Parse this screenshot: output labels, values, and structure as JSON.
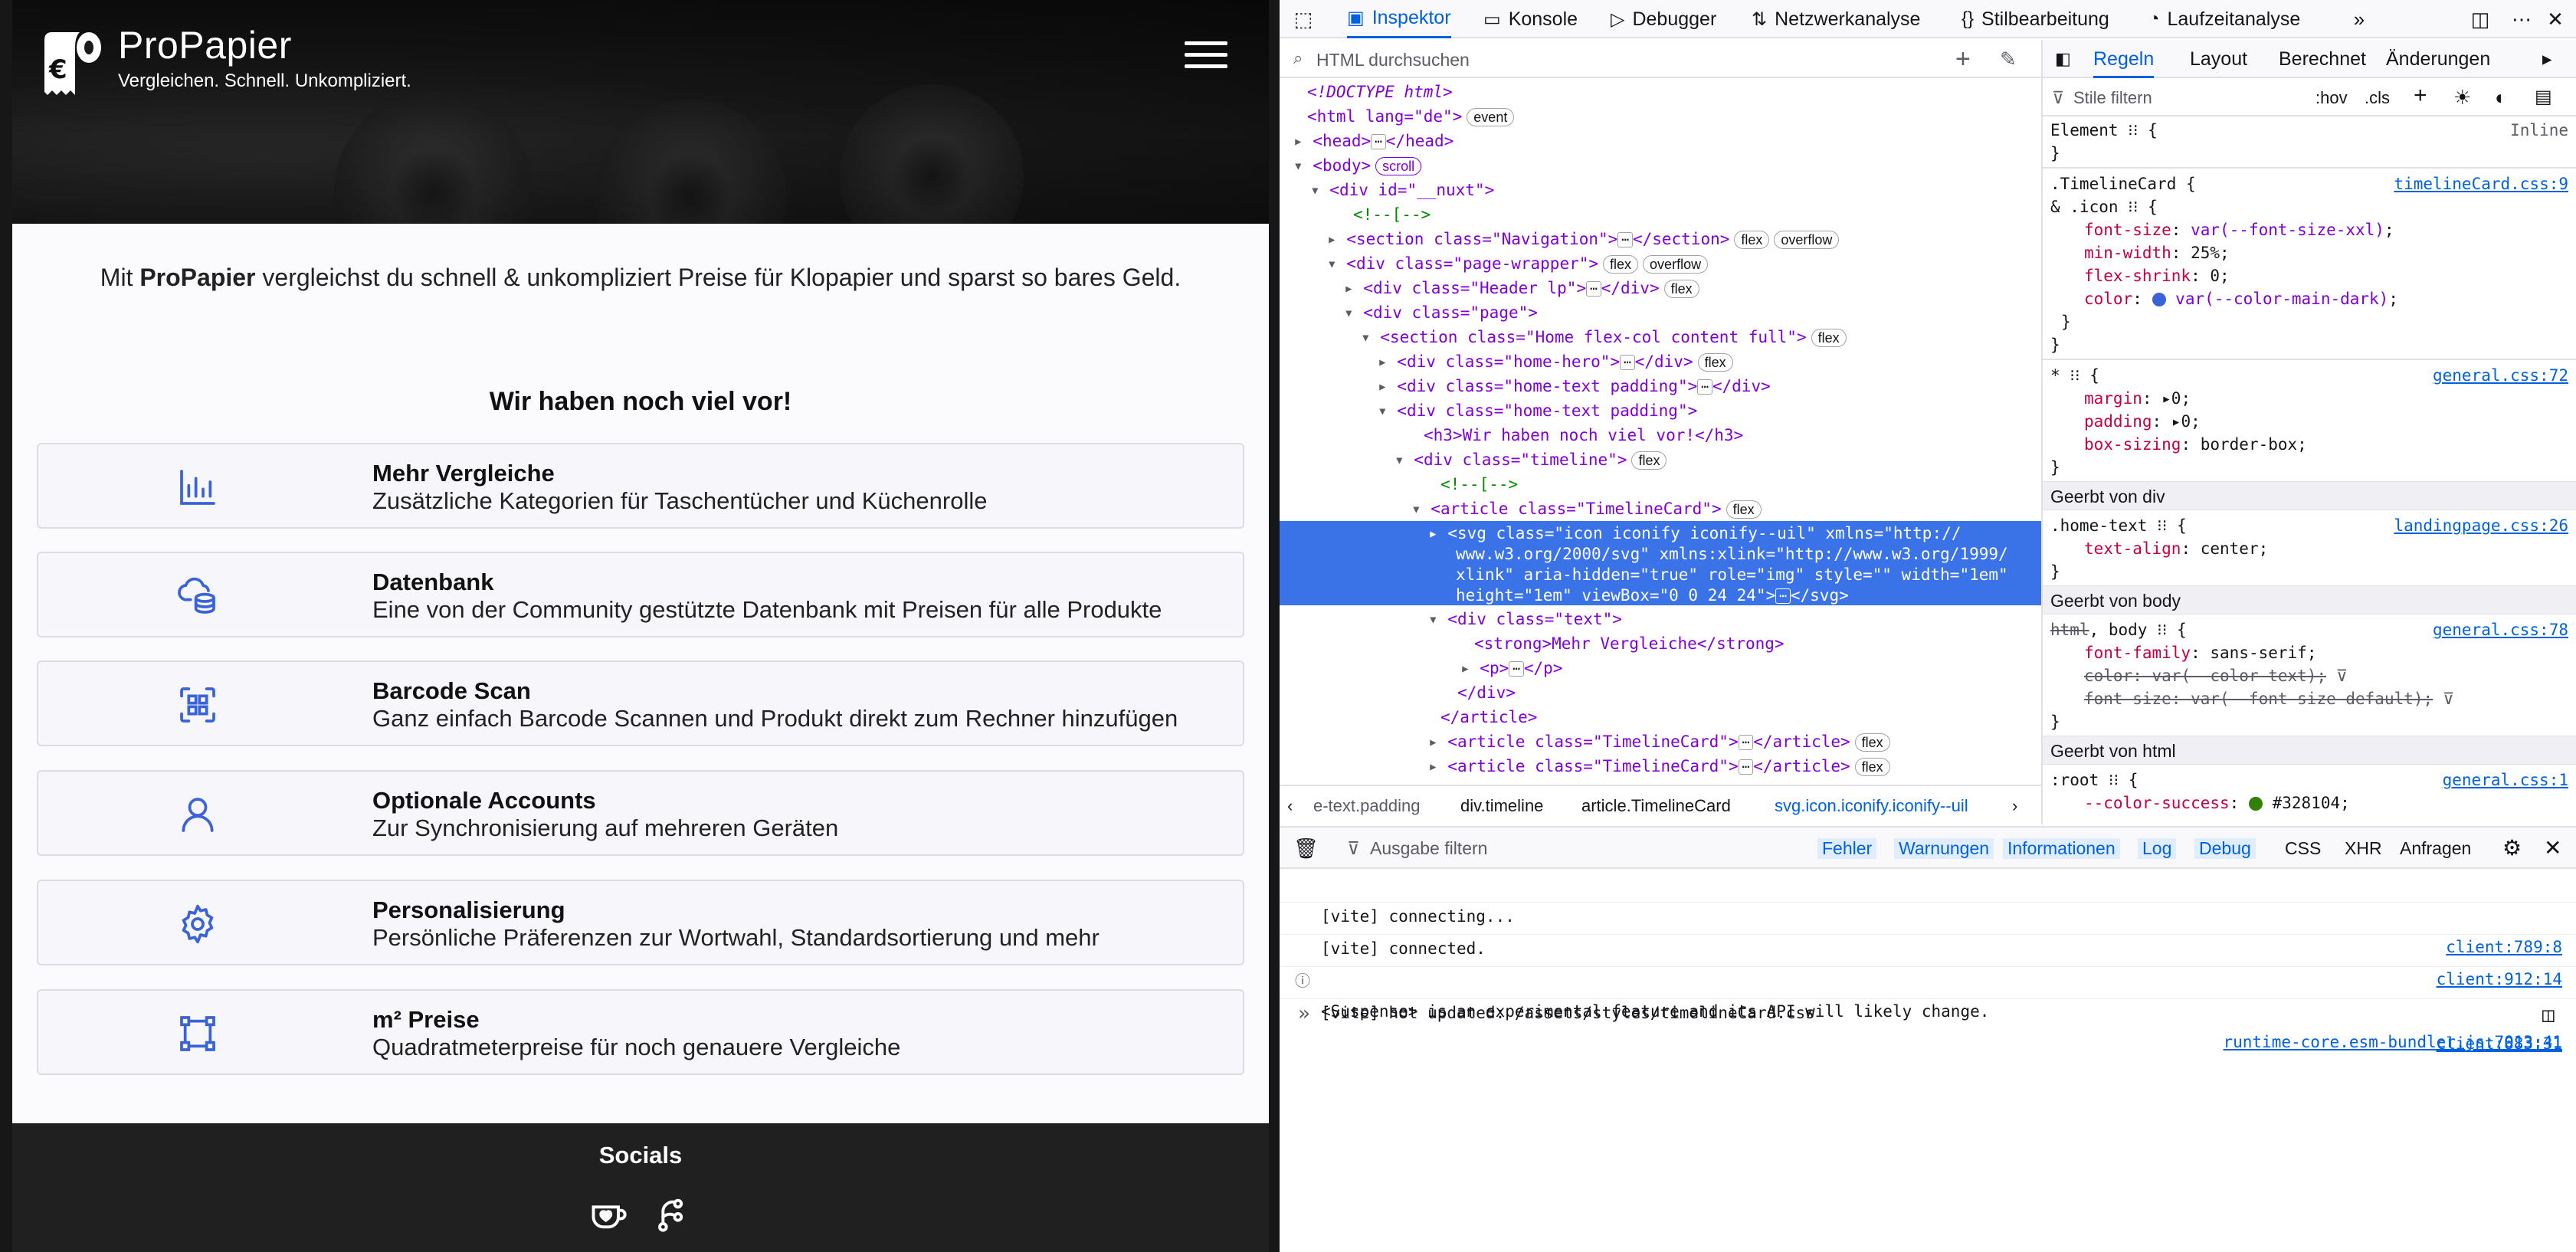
{
  "site": {
    "brand_name": "ProPapier",
    "tagline": "Vergleichen. Schnell. Unkompliziert.",
    "intro_pre": "Mit ",
    "intro_bold": "ProPapier",
    "intro_post": " vergleichst du schnell & unkompliziert Preise für Klopapier und sparst so bares Geld.",
    "section_title": "Wir haben noch viel vor!",
    "accent_color": "#3b63d8",
    "features": [
      {
        "icon": "chart-bars-icon",
        "title": "Mehr Vergleiche",
        "text": "Zusätzliche Kategorien für Taschentücher und Küchenrolle"
      },
      {
        "icon": "cloud-database-icon",
        "title": "Datenbank",
        "text": "Eine von der Community gestützte Datenbank mit Preisen für alle Produkte"
      },
      {
        "icon": "qr-scan-icon",
        "title": "Barcode Scan",
        "text": "Ganz einfach Barcode Scannen und Produkt direkt zum Rechner hinzufügen"
      },
      {
        "icon": "user-icon",
        "title": "Optionale Accounts",
        "text": "Zur Synchronisierung auf mehreren Geräten"
      },
      {
        "icon": "gear-icon",
        "title": "Personalisierung",
        "text": "Persönliche Präferenzen zur Wortwahl, Standardsortierung und mehr"
      },
      {
        "icon": "square-nodes-icon",
        "title": "m² Preise",
        "text": "Quadratmeterpreise für noch genauere Vergleiche"
      }
    ],
    "socials_title": "Socials"
  },
  "devtools": {
    "tabs": [
      "Inspektor",
      "Konsole",
      "Debugger",
      "Netzwerkanalyse",
      "Stilbearbeitung",
      "Laufzeitanalyse"
    ],
    "search_placeholder": "HTML durchsuchen",
    "rules_tabs": [
      "Regeln",
      "Layout",
      "Berechnet",
      "Änderungen"
    ],
    "filter_placeholder": "Stile filtern",
    "hov": ":hov",
    "cls": ".cls",
    "breadcrumb": [
      "e-text.padding",
      "div.timeline",
      "article.TimelineCard",
      "svg.icon.iconify.iconify--uil"
    ],
    "tree": {
      "doctype": "<!DOCTYPE html>",
      "html_open": "<html lang=\"de\">",
      "head": "<head>",
      "head_close": "</head>",
      "body": "<body>",
      "nuxt": "<div id=\"__nuxt\">",
      "comment1": "<!--[-->",
      "nav": "<section class=\"Navigation\">",
      "nav_close": "</section>",
      "wrapper": "<div class=\"page-wrapper\">",
      "header": "<div class=\"Header lp\">",
      "div_close": "</div>",
      "page": "<div class=\"page\">",
      "home": "<section class=\"Home flex-col content full\">",
      "hero": "<div class=\"home-hero\">",
      "hometext1": "<div class=\"home-text padding\">",
      "hometext2": "<div class=\"home-text padding\">",
      "h3": "<h3>Wir haben noch viel vor!</h3>",
      "timeline": "<div class=\"timeline\">",
      "comment2": "<!--[-->",
      "article": "<article class=\"TimelineCard\">",
      "svg_l1": "<svg class=\"icon iconify iconify--uil\" xmlns=\"http://",
      "svg_l2": "www.w3.org/2000/svg\" xmlns:xlink=\"http://www.w3.org/1999/",
      "svg_l3": "xlink\" aria-hidden=\"true\" role=\"img\" style=\"\" width=\"1em\"",
      "svg_l4": "height=\"1em\" viewBox=\"0 0 24 24\">",
      "svg_close": "</svg>",
      "text_div": "<div class=\"text\">",
      "strong": "<strong>Mehr Vergleiche</strong>",
      "p": "<p>",
      "p_close": "</p>",
      "div_end": "</div>",
      "article_end": "</article>",
      "article2": "<article class=\"TimelineCard\">",
      "article3": "<article class=\"TimelineCard\">",
      "article_close": "</article>",
      "badges": {
        "event": "event",
        "scroll": "scroll",
        "flex": "flex",
        "overflow": "overflow"
      }
    },
    "rules": {
      "element": "Element",
      "inline": "Inline",
      "r1_sel": ".TimelineCard {",
      "r1_sub": "& .icon",
      "r1_src": "timelineCard.css:9",
      "r1_p1": "font-size",
      "r1_v1": "var(--font-size-xxl)",
      "r1_p2": "min-width",
      "r1_v2": "25%",
      "r1_p3": "flex-shrink",
      "r1_v3": "0",
      "r1_p4": "color",
      "r1_v4": "var(--color-main-dark)",
      "r2_sel": "*",
      "r2_src": "general.css:72",
      "r2_p1": "margin",
      "r2_v1": "0",
      "r2_p2": "padding",
      "r2_v2": "0",
      "r2_p3": "box-sizing",
      "r2_v3": "border-box",
      "inh_div": "Geerbt von div",
      "r3_sel": ".home-text",
      "r3_src": "landingpage.css:26",
      "r3_p1": "text-align",
      "r3_v1": "center",
      "inh_body": "Geerbt von body",
      "r4_sel_s": "html",
      "r4_sel": ", body",
      "r4_src": "general.css:78",
      "r4_p1": "font-family",
      "r4_v1": "sans-serif",
      "r4_p2": "color",
      "r4_v2": "var(--color-text)",
      "r4_p3": "font-size",
      "r4_v3": "var(--font-size-default)",
      "inh_html": "Geerbt von html",
      "r5_sel": ":root",
      "r5_src": "general.css:1",
      "r5_p1": "--color-success",
      "r5_v1": "#328104"
    },
    "console_bar": {
      "filter_placeholder": "Ausgabe filtern",
      "levels": [
        "Fehler",
        "Warnungen",
        "Informationen",
        "Log",
        "Debug"
      ],
      "types": [
        "CSS",
        "XHR",
        "Anfragen"
      ]
    },
    "console": [
      {
        "msg": "[vite] connecting...",
        "src": "client:789:8"
      },
      {
        "msg": "[vite] connected.",
        "src": "client:912:14"
      },
      {
        "msg": "<Suspense> is an experimental feature and its API will likely change.",
        "src": "runtime-core.esm-bundler.js:7013:41"
      },
      {
        "msg": "[vite] hot updated: /assets/styles/timelineCard.css",
        "src": "client:883:31"
      }
    ],
    "prompt": "»"
  }
}
